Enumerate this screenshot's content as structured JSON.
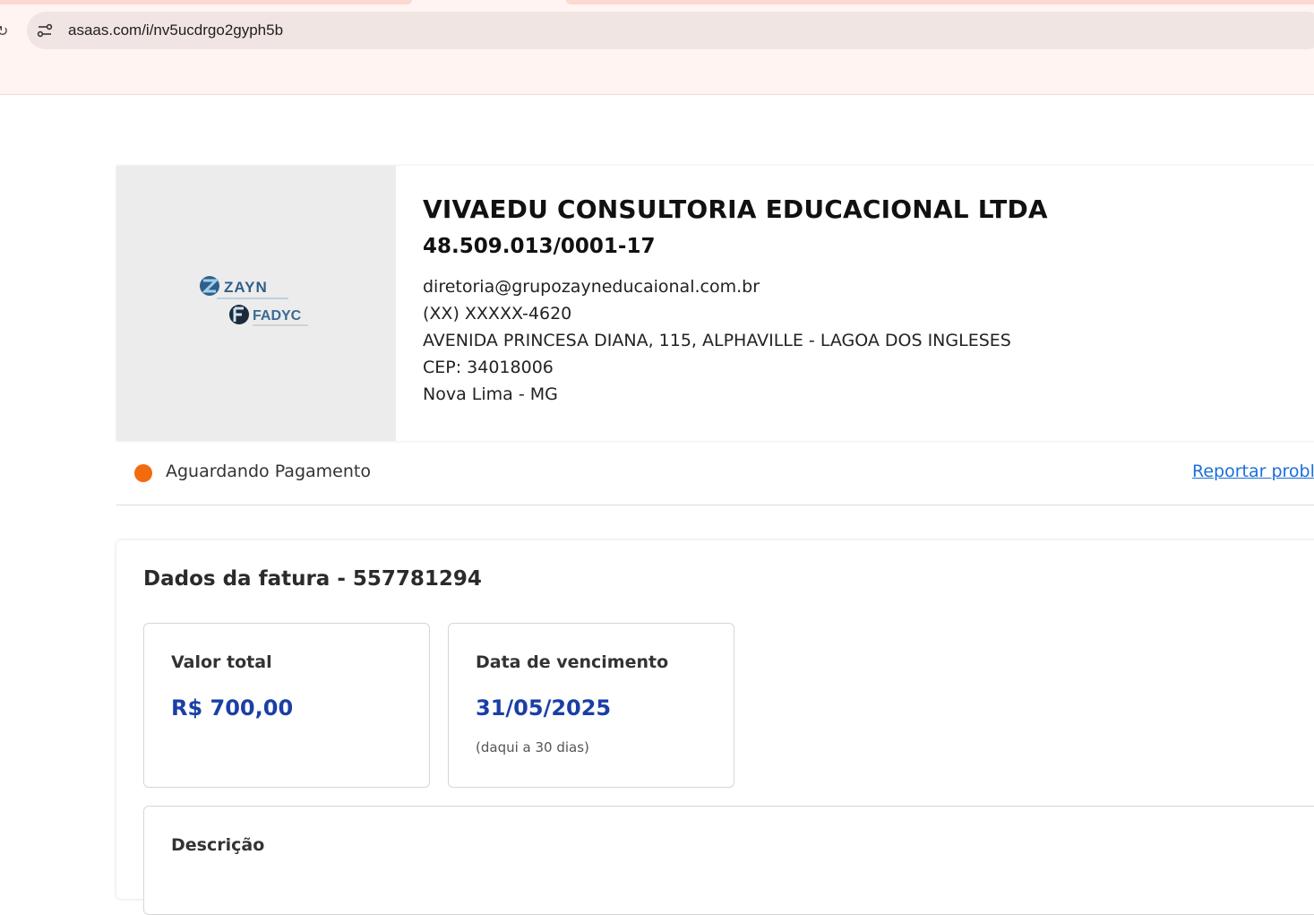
{
  "browser": {
    "url": "asaas.com/i/nv5ucdrgo2gyph5b"
  },
  "logo": {
    "brand_1": "ZAYN",
    "brand_2": "FADYC"
  },
  "company": {
    "name": "VIVAEDU CONSULTORIA EDUCACIONAL LTDA",
    "cnpj": "48.509.013/0001-17",
    "email": "diretoria@grupozayneducaional.com.br",
    "phone": "(XX) XXXXX-4620",
    "address": "AVENIDA PRINCESA DIANA, 115, ALPHAVILLE - LAGOA DOS INGLESES",
    "cep": "CEP: 34018006",
    "city": "Nova Lima - MG"
  },
  "status": {
    "label": "Aguardando Pagamento",
    "color": "#f26b0f",
    "report_link": "Reportar probl"
  },
  "invoice": {
    "title": "Dados da fatura - 557781294",
    "total_label": "Valor total",
    "total_value": "R$ 700,00",
    "due_label": "Data de vencimento",
    "due_value": "31/05/2025",
    "due_note": "(daqui a 30 dias)",
    "description_label": "Descrição"
  }
}
